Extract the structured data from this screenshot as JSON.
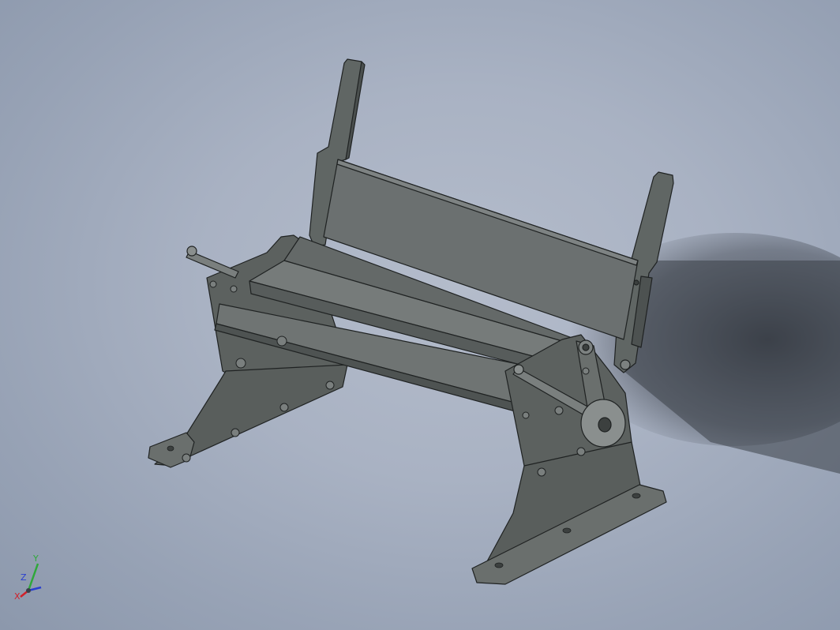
{
  "viewport": {
    "background": "#a9b2c3",
    "part_color": "#636866",
    "part_dark": "#4a4f4e",
    "part_light": "#7c8180",
    "edge_color": "#1f2222"
  },
  "model": {
    "description_icon": "sheet-metal-bending-brake-model"
  },
  "triad": {
    "x_label": "X",
    "y_label": "Y",
    "z_label": "Z",
    "x_color": "#d0202a",
    "y_color": "#2fa83a",
    "z_color": "#2a3fcf"
  }
}
